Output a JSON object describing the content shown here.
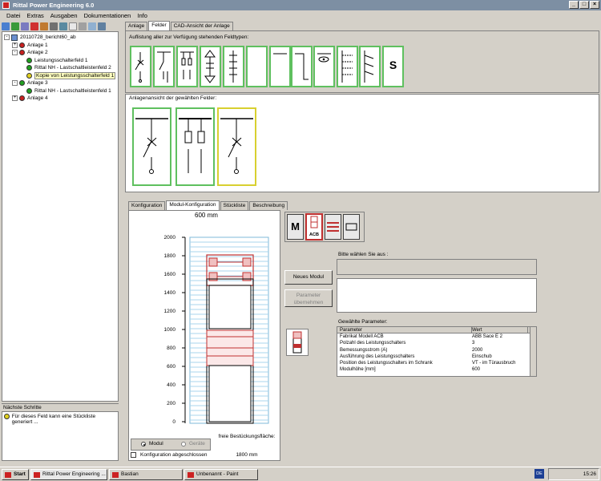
{
  "window": {
    "title": "Rittal Power Engineering 6.0",
    "min": "_",
    "max": "□",
    "close": "×"
  },
  "menu": [
    "Datei",
    "Extras",
    "Ausgaben",
    "Dokumentationen",
    "Info"
  ],
  "tree": {
    "root": "20110728_bericht60_ab",
    "items": [
      {
        "label": "Anlage 1",
        "color": "#c82020",
        "level": 1,
        "exp": "+"
      },
      {
        "label": "Anlage 2",
        "color": "#c82020",
        "level": 1,
        "exp": "-"
      },
      {
        "label": "Leistungsschalterfeld 1",
        "color": "#20a020",
        "level": 2
      },
      {
        "label": "Rittal NH - Lastschaltleistenfeld 2",
        "color": "#20a020",
        "level": 2
      },
      {
        "label": "Kopie von Leistungsschalterfeld 1",
        "color": "#e0d020",
        "level": 2,
        "selected": true
      },
      {
        "label": "Anlage 3",
        "color": "#20a020",
        "level": 1,
        "exp": "-"
      },
      {
        "label": "Rittal NH - Lastschaltleistenfeld 1",
        "color": "#20a020",
        "level": 2
      },
      {
        "label": "Anlage 4",
        "color": "#c82020",
        "level": 1,
        "exp": "+"
      }
    ]
  },
  "steps": {
    "title": "Nächste Schritte",
    "message": "Für dieses Feld kann eine Stückliste generiert ..."
  },
  "top_tabs": [
    "Anlage",
    "Felder",
    "CAD-Ansicht der Anlage"
  ],
  "available_fields_label": "Auflistung aller zur Verfügung stehenden Feldtypen:",
  "field_s_label": "S",
  "layout_view_label": "Anlagenansicht der gewählten Felder:",
  "bottom_tabs": [
    "Konfiguration",
    "Modul-Konfiguration",
    "Stückliste",
    "Beschreibung"
  ],
  "cabinet": {
    "width_label": "600 mm",
    "y_ticks": [
      "2000",
      "1800",
      "1600",
      "1400",
      "1200",
      "1000",
      "800",
      "600",
      "400",
      "200",
      "0"
    ]
  },
  "mode": {
    "modul": "Modul",
    "geraete": "Geräte",
    "free_label": "freie Bestückungsfläche:",
    "free_value": "1800 mm",
    "config_done": "Konfiguration abgeschlossen"
  },
  "module_types": {
    "m": "M",
    "acb": "ACB"
  },
  "buttons": {
    "new_module": "Neues Modul",
    "accept_params": "Parameter übernehmen"
  },
  "choose_label": "Bitte wählen Sie aus :",
  "params": {
    "label": "Gewählte Parameter:",
    "headers": [
      "Parameter",
      "Wert"
    ],
    "rows": [
      [
        "Fabrikat Modell ACB",
        "ABB Sace E 2"
      ],
      [
        "Polzahl des Leistungsschalters",
        "3"
      ],
      [
        "Bemessungsstrom (A)",
        "2000"
      ],
      [
        "Ausführung des Leistungsschalters",
        "Einschub"
      ],
      [
        "Position des Leistungsschalters im Schrank",
        "VT - im Türausbruch"
      ],
      [
        "Modulhöhe [mm]",
        "600"
      ]
    ]
  },
  "taskbar": {
    "start": "Start",
    "tasks": [
      "Rittal Power Engineering ...",
      "Bastian",
      "Unbenannt - Paint"
    ],
    "lang": "DE",
    "clock": "15:26"
  }
}
